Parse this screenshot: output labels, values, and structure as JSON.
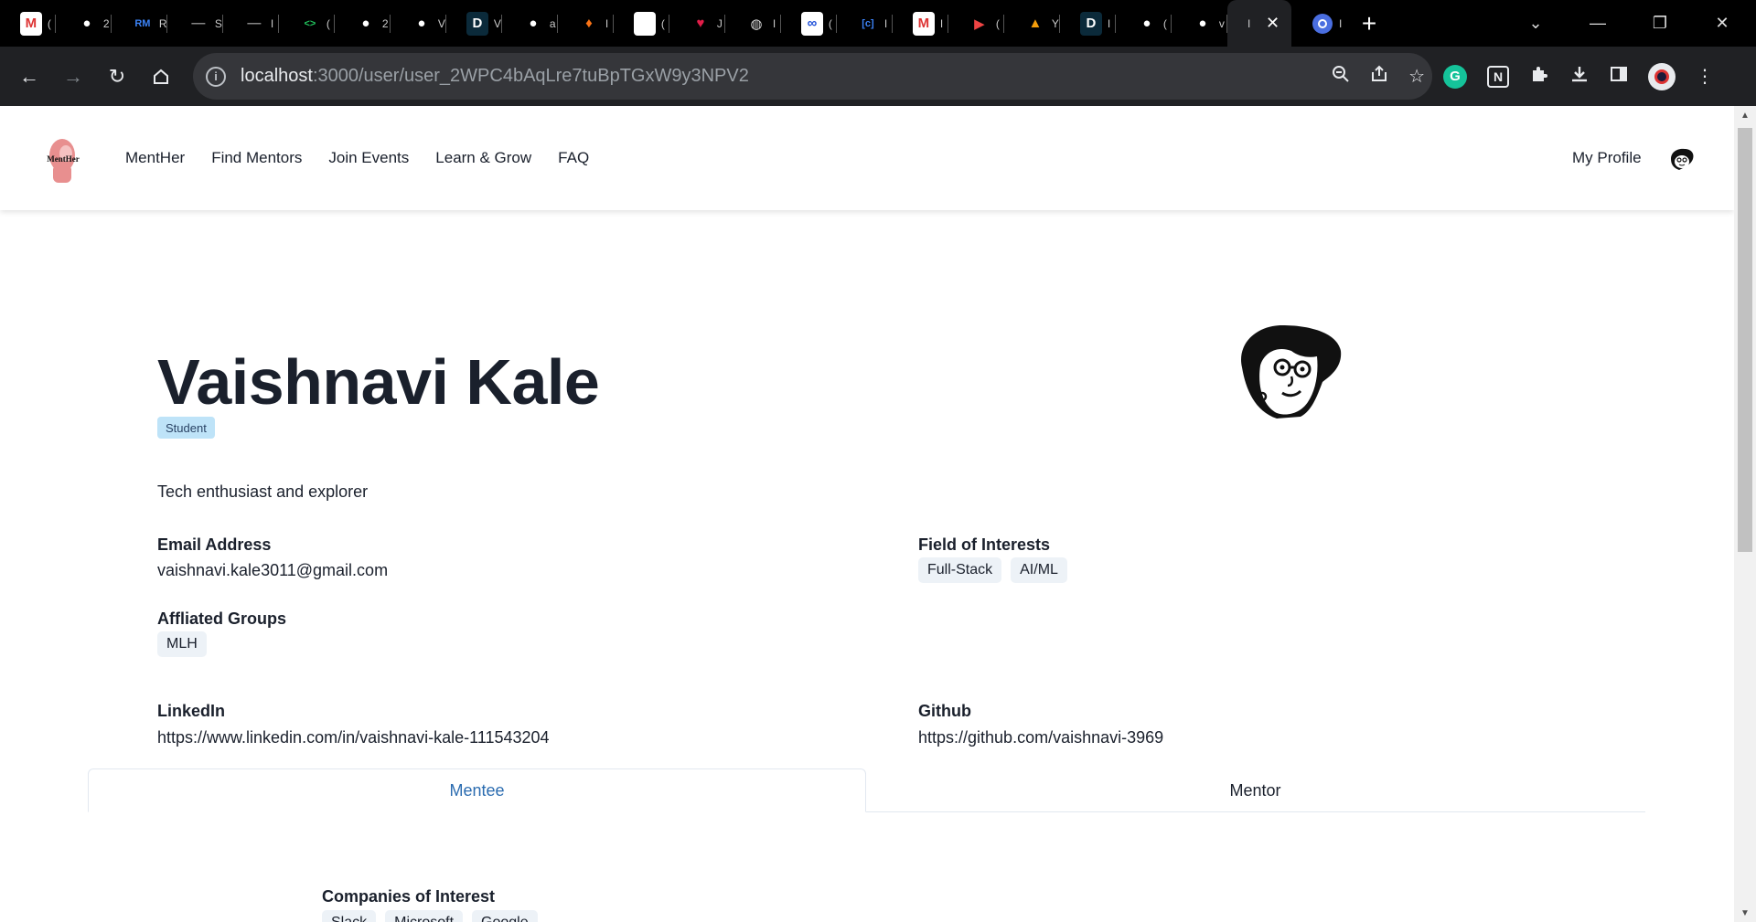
{
  "browser": {
    "tabs": [
      {
        "icon": "gmail-icon",
        "label": "("
      },
      {
        "icon": "github-icon",
        "label": "2"
      },
      {
        "icon": "rm-icon",
        "label": "R"
      },
      {
        "icon": "blank-icon",
        "label": "S"
      },
      {
        "icon": "blank-icon",
        "label": "I"
      },
      {
        "icon": "code-icon",
        "label": "("
      },
      {
        "icon": "github-icon",
        "label": "2"
      },
      {
        "icon": "github-icon",
        "label": "V"
      },
      {
        "icon": "d-icon",
        "label": "V"
      },
      {
        "icon": "github-icon",
        "label": "a"
      },
      {
        "icon": "flame-icon",
        "label": "I"
      },
      {
        "icon": "white-square-icon",
        "label": "("
      },
      {
        "icon": "heart-icon",
        "label": "J"
      },
      {
        "icon": "globe-icon",
        "label": "I"
      },
      {
        "icon": "link-icon",
        "label": "("
      },
      {
        "icon": "doc-icon",
        "label": "I"
      },
      {
        "icon": "gmail-icon",
        "label": "I"
      },
      {
        "icon": "youtube-icon",
        "label": "("
      },
      {
        "icon": "firebase-icon",
        "label": "Y"
      },
      {
        "icon": "d-icon",
        "label": "I"
      },
      {
        "icon": "github-icon",
        "label": "("
      },
      {
        "icon": "github-icon",
        "label": "v"
      }
    ],
    "active_tab": {
      "label": "I",
      "close": "✕"
    },
    "after_tab": {
      "icon": "chrome-icon",
      "label": "I"
    },
    "new_tab": "+",
    "url_host": "localhost",
    "url_rest": ":3000/user/user_2WPC4bAqLre7tuBpTGxW9y3NPV2"
  },
  "nav": {
    "links": [
      "MentHer",
      "Find Mentors",
      "Join Events",
      "Learn & Grow",
      "FAQ"
    ],
    "logo_text": "MentHer",
    "my_profile": "My Profile"
  },
  "profile": {
    "name": "Vaishnavi Kale",
    "role_badge": "Student",
    "bio": "Tech enthusiast and explorer",
    "email_label": "Email Address",
    "email": "vaishnavi.kale3011@gmail.com",
    "interests_label": "Field of Interests",
    "interests": [
      "Full-Stack",
      "AI/ML"
    ],
    "groups_label": "Affliated Groups",
    "groups": [
      "MLH"
    ],
    "linkedin_label": "LinkedIn",
    "linkedin": "https://www.linkedin.com/in/vaishnavi-kale-111543204",
    "github_label": "Github",
    "github": "https://github.com/vaishnavi-3969"
  },
  "tabs": {
    "mentee": "Mentee",
    "mentor": "Mentor"
  },
  "mentee": {
    "companies_label": "Companies of Interest",
    "companies": [
      "Slack",
      "Microsoft",
      "Google"
    ]
  },
  "colors": {
    "tab_selected": "#2b6cb0",
    "badge_bg": "#bee3f8",
    "chip_bg": "#edf2f7",
    "text": "#1a202c"
  }
}
